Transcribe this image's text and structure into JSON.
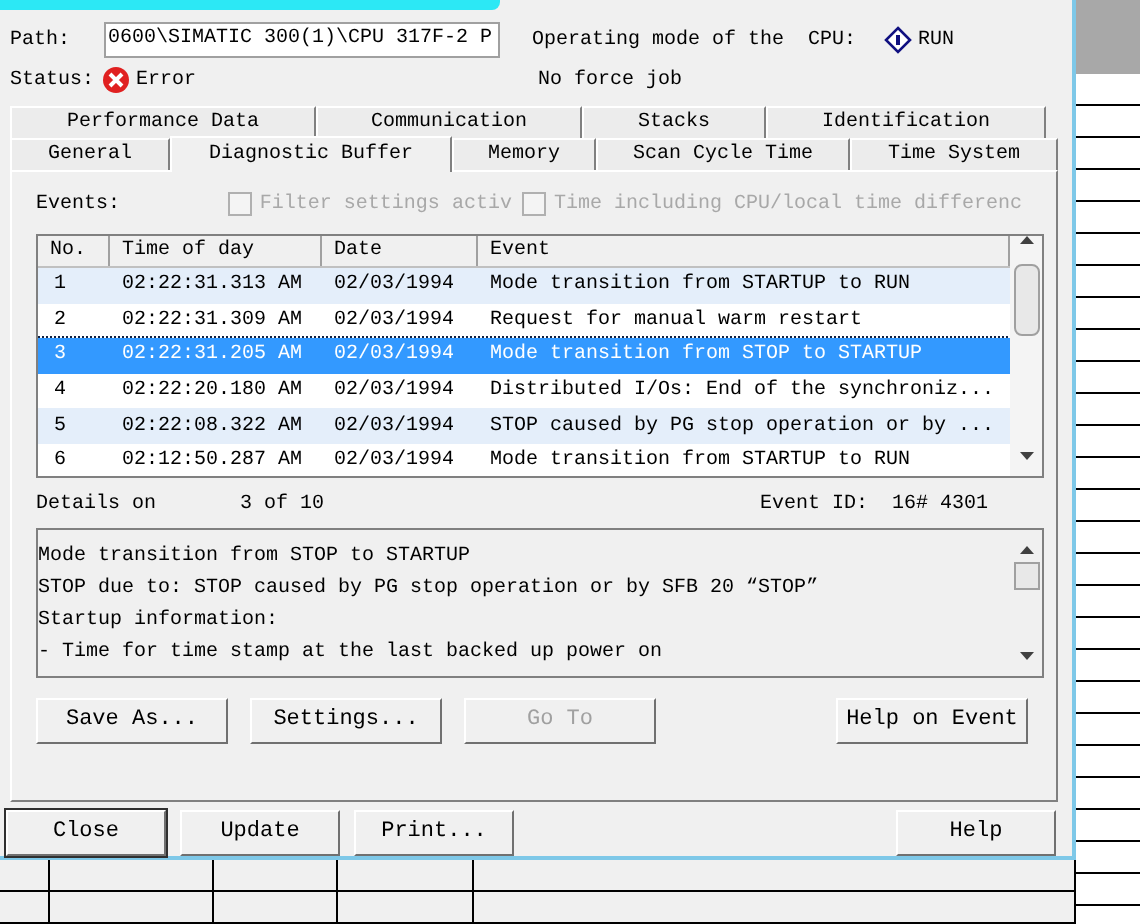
{
  "header": {
    "path_label": "Path:",
    "path": "0600\\SIMATIC 300(1)\\CPU 317F-2 P",
    "mode_label": "Operating mode of the  CPU:",
    "mode": "RUN",
    "status_label": "Status:",
    "status": "Error",
    "force": "No force job"
  },
  "tab_rows": [
    [
      {
        "label": "Performance Data",
        "selected": false
      },
      {
        "label": "Communication",
        "selected": false
      },
      {
        "label": "Stacks",
        "selected": false
      },
      {
        "label": "Identification",
        "selected": false
      }
    ],
    [
      {
        "label": "General",
        "selected": false
      },
      {
        "label": "Diagnostic Buffer",
        "selected": true
      },
      {
        "label": "Memory",
        "selected": false
      },
      {
        "label": "Scan Cycle Time",
        "selected": false
      },
      {
        "label": "Time System",
        "selected": false
      }
    ]
  ],
  "events_label": "Events:",
  "options": [
    {
      "label": "Filter settings activ",
      "checked": false,
      "disabled": true
    },
    {
      "label": "Time including CPU/local time differenc",
      "checked": false,
      "disabled": true
    }
  ],
  "table": {
    "columns": [
      "No.",
      "Time of day",
      "Date",
      "Event"
    ],
    "rows": [
      {
        "cells": [
          "1",
          "02:22:31.313 AM",
          "02/03/1994",
          "Mode transition from STARTUP to RUN"
        ],
        "selected": false
      },
      {
        "cells": [
          "2",
          "02:22:31.309 AM",
          "02/03/1994",
          "Request for manual warm restart"
        ],
        "selected": false
      },
      {
        "cells": [
          "3",
          "02:22:31.205 AM",
          "02/03/1994",
          "Mode transition from STOP to STARTUP"
        ],
        "selected": true
      },
      {
        "cells": [
          "4",
          "02:22:20.180 AM",
          "02/03/1994",
          "Distributed I/Os: End of the synchroniz..."
        ],
        "selected": false
      },
      {
        "cells": [
          "5",
          "02:22:08.322 AM",
          "02/03/1994",
          "STOP caused by PG stop operation or by ..."
        ],
        "selected": false
      },
      {
        "cells": [
          "6",
          "02:12:50.287 AM",
          "02/03/1994",
          "Mode transition from STARTUP to RUN"
        ],
        "selected": false
      }
    ]
  },
  "details": {
    "label": "Details on",
    "position": "3 of 10",
    "event_id": "Event ID:  16# 4301",
    "lines": [
      "Mode transition from STOP to STARTUP",
      "STOP due to: STOP caused by PG stop operation or by SFB 20 “STOP”",
      "Startup information:",
      "- Time for time stamp at the last backed up power on"
    ]
  },
  "panel_buttons": [
    {
      "label": "Save As...",
      "disabled": false
    },
    {
      "label": "Settings...",
      "disabled": false
    },
    {
      "label": "Go To",
      "disabled": true
    },
    {
      "label": "Help on Event",
      "disabled": false
    }
  ],
  "dialog_buttons": [
    {
      "label": "Close",
      "default": true
    },
    {
      "label": "Update",
      "default": false
    },
    {
      "label": "Print...",
      "default": false
    },
    {
      "label": "Help",
      "default": false
    }
  ]
}
